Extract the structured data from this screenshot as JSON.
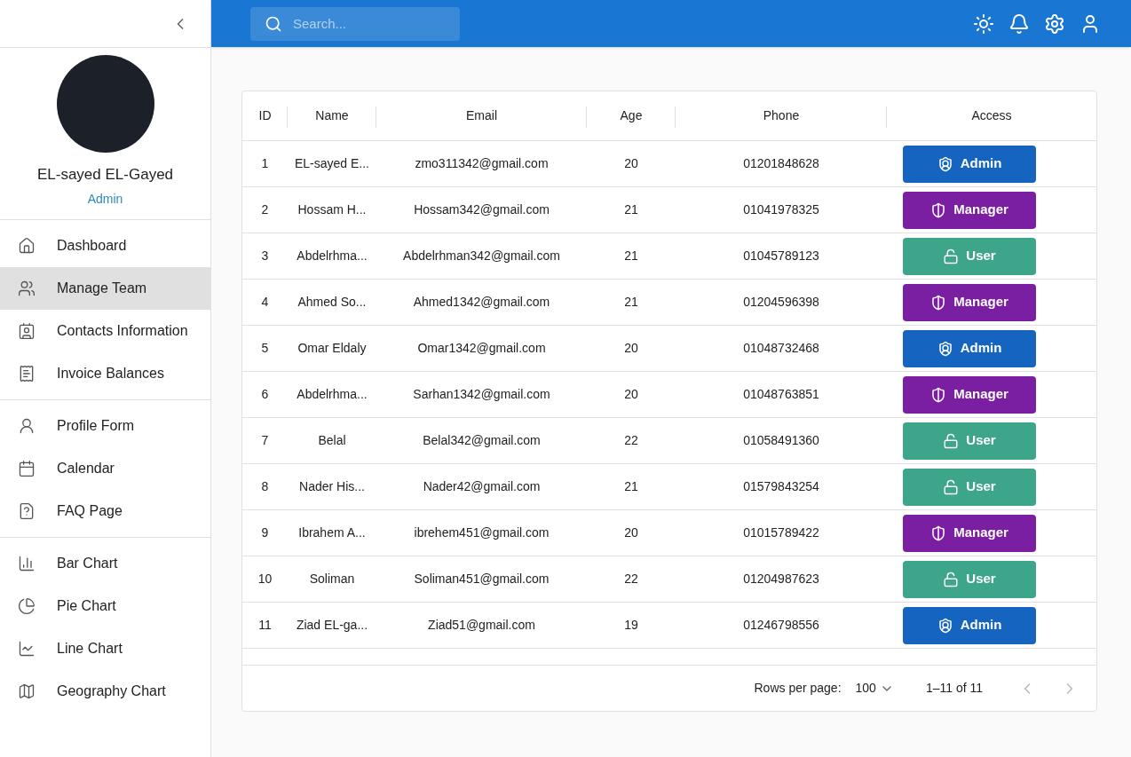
{
  "sidebar": {
    "profile": {
      "name": "EL-sayed EL-Gayed",
      "role": "Admin"
    },
    "groups": [
      [
        {
          "label": "Dashboard",
          "selected": false
        },
        {
          "label": "Manage Team",
          "selected": true
        },
        {
          "label": "Contacts Information",
          "selected": false
        },
        {
          "label": "Invoice Balances",
          "selected": false
        }
      ],
      [
        {
          "label": "Profile Form",
          "selected": false
        },
        {
          "label": "Calendar",
          "selected": false
        },
        {
          "label": "FAQ Page",
          "selected": false
        }
      ],
      [
        {
          "label": "Bar Chart",
          "selected": false
        },
        {
          "label": "Pie Chart",
          "selected": false
        },
        {
          "label": "Line Chart",
          "selected": false
        },
        {
          "label": "Geography Chart",
          "selected": false
        }
      ]
    ]
  },
  "topbar": {
    "search": {
      "placeholder": "Search..."
    }
  },
  "table": {
    "columns": [
      "ID",
      "Name",
      "Email",
      "Age",
      "Phone",
      "Access"
    ],
    "rows": [
      {
        "id": "1",
        "name": "EL-sayed E...",
        "email": "zmo311342@gmail.com",
        "age": "20",
        "phone": "01201848628",
        "access": {
          "kind": "admin",
          "label": "Admin"
        }
      },
      {
        "id": "2",
        "name": "Hossam H...",
        "email": "Hossam342@gmail.com",
        "age": "21",
        "phone": "01041978325",
        "access": {
          "kind": "manager",
          "label": "Manager"
        }
      },
      {
        "id": "3",
        "name": "Abdelrhma...",
        "email": "Abdelrhman342@gmail.com",
        "age": "21",
        "phone": "01045789123",
        "access": {
          "kind": "user",
          "label": "User"
        }
      },
      {
        "id": "4",
        "name": "Ahmed So...",
        "email": "Ahmed1342@gmail.com",
        "age": "21",
        "phone": "01204596398",
        "access": {
          "kind": "manager",
          "label": "Manager"
        }
      },
      {
        "id": "5",
        "name": "Omar Eldaly",
        "email": "Omar1342@gmail.com",
        "age": "20",
        "phone": "01048732468",
        "access": {
          "kind": "admin",
          "label": "Admin"
        }
      },
      {
        "id": "6",
        "name": "Abdelrhma...",
        "email": "Sarhan1342@gmail.com",
        "age": "20",
        "phone": "01048763851",
        "access": {
          "kind": "manager",
          "label": "Manager"
        }
      },
      {
        "id": "7",
        "name": "Belal",
        "email": "Belal342@gmail.com",
        "age": "22",
        "phone": "01058491360",
        "access": {
          "kind": "user",
          "label": "User"
        }
      },
      {
        "id": "8",
        "name": "Nader His...",
        "email": "Nader42@gmail.com",
        "age": "21",
        "phone": "01579843254",
        "access": {
          "kind": "user",
          "label": "User"
        }
      },
      {
        "id": "9",
        "name": "Ibrahem A...",
        "email": "ibrehem451@gmail.com",
        "age": "20",
        "phone": "01015789422",
        "access": {
          "kind": "manager",
          "label": "Manager"
        }
      },
      {
        "id": "10",
        "name": "Soliman",
        "email": "Soliman451@gmail.com",
        "age": "22",
        "phone": "01204987623",
        "access": {
          "kind": "user",
          "label": "User"
        }
      },
      {
        "id": "11",
        "name": "Ziad EL-ga...",
        "email": "Ziad51@gmail.com",
        "age": "19",
        "phone": "01246798556",
        "access": {
          "kind": "admin",
          "label": "Admin"
        }
      }
    ],
    "pagination": {
      "rows_per_page_label": "Rows per page:",
      "rows_per_page": "100",
      "range": "1–11 of 11"
    }
  }
}
